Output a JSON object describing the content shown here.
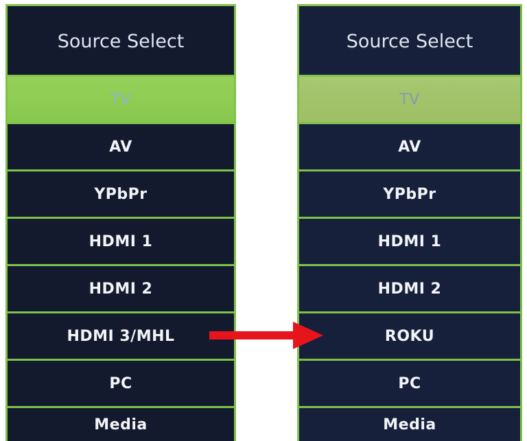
{
  "left_panel": {
    "title": "Source Select",
    "items": [
      "TV",
      "AV",
      "YPbPr",
      "HDMI 1",
      "HDMI 2",
      "HDMI 3/MHL",
      "PC",
      "Media"
    ],
    "selected": "TV"
  },
  "right_panel": {
    "title": "Source Select",
    "items": [
      "TV",
      "AV",
      "YPbPr",
      "HDMI 1",
      "HDMI 2",
      "ROKU",
      "PC",
      "Media"
    ],
    "selected": "TV"
  },
  "arrow": {
    "icon": "right-arrow-icon",
    "color": "#e8141c"
  },
  "colors": {
    "accent_green": "#7ec24a",
    "menu_background": "#141a2d"
  }
}
